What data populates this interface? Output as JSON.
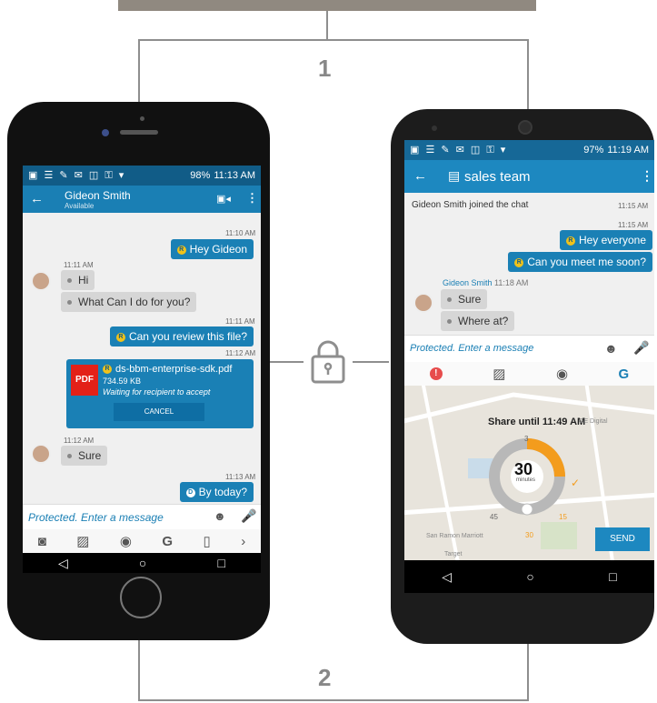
{
  "labels": {
    "top": "1",
    "bottom": "2"
  },
  "left_phone": {
    "status": {
      "battery": "98%",
      "time": "11:13 AM"
    },
    "contact_name": "Gideon Smith",
    "contact_status": "Available",
    "messages": [
      {
        "time": "11:10 AM",
        "text": "Hey Gideon",
        "dir": "out",
        "badge": "R"
      },
      {
        "time": "11:11 AM",
        "text": "Hi",
        "dir": "in"
      },
      {
        "text": "What Can I do for you?",
        "dir": "in"
      },
      {
        "time": "11:11 AM",
        "text": "Can you review this file?",
        "dir": "out",
        "badge": "R"
      },
      {
        "time": "11:12 AM",
        "dir": "file"
      },
      {
        "time": "11:12 AM",
        "text": "Sure",
        "dir": "in"
      },
      {
        "time": "11:13 AM",
        "text": "By today?",
        "dir": "out",
        "badge": "D"
      }
    ],
    "file": {
      "badge": "PDF",
      "name": "ds-bbm-enterprise-sdk.pdf",
      "size": "734.59 KB",
      "status": "Waiting for recipient to accept",
      "cancel": "CANCEL",
      "state_badge": "R"
    },
    "compose_placeholder": "Protected. Enter a message"
  },
  "right_phone": {
    "status": {
      "battery": "97%",
      "time": "11:19 AM"
    },
    "chat_title": "sales team",
    "system_line": "Gideon Smith joined the chat",
    "system_time": "11:15 AM",
    "messages": [
      {
        "time": "11:15 AM",
        "text": "Hey everyone",
        "dir": "out",
        "badge": "R"
      },
      {
        "text": "Can you meet me soon?",
        "dir": "out",
        "badge": "R"
      },
      {
        "sender": "Gideon Smith",
        "time": "11:18 AM",
        "text": "Sure",
        "dir": "in"
      },
      {
        "text": "Where at?",
        "dir": "in"
      }
    ],
    "compose_placeholder": "Protected. Enter a message",
    "share": {
      "label": "Share until 11:49 AM",
      "value": "30",
      "unit": "minutes",
      "ticks": [
        "3",
        "45",
        "15",
        "30"
      ],
      "send": "SEND"
    },
    "map_labels": [
      "GE Digital",
      "San Ramon Marriott",
      "Target"
    ]
  },
  "colors": {
    "bar": "#115c87",
    "accent": "#1a7fb4",
    "badge": "#f0c21b",
    "orange": "#f39c1d"
  }
}
